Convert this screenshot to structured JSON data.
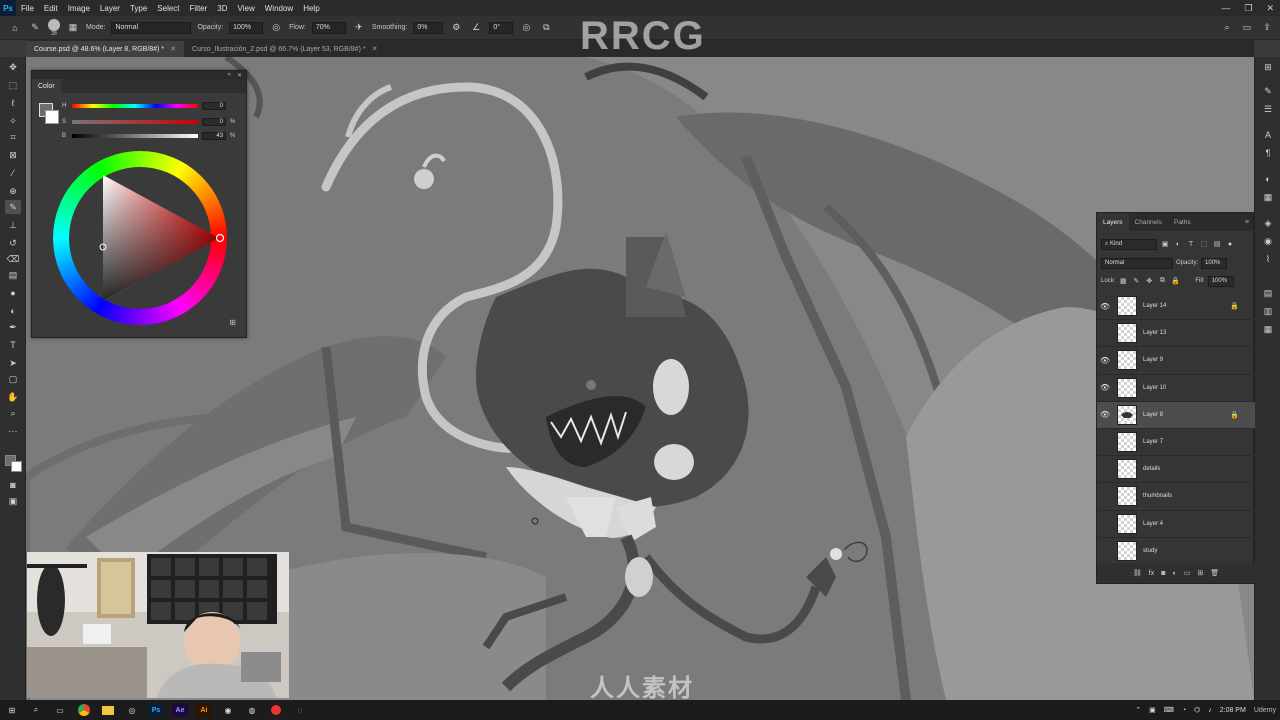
{
  "app": {
    "logo": "Ps"
  },
  "menu": [
    "File",
    "Edit",
    "Image",
    "Layer",
    "Type",
    "Select",
    "Filter",
    "3D",
    "View",
    "Window",
    "Help"
  ],
  "window_controls": [
    "—",
    "❐",
    "✕"
  ],
  "options": {
    "brush_size": "28",
    "mode_label": "Mode:",
    "mode_value": "Normal",
    "opacity_label": "Opacity:",
    "opacity_value": "100%",
    "flow_label": "Flow:",
    "flow_value": "70%",
    "smoothing_label": "Smoothing:",
    "smoothing_value": "0%",
    "angle_value": "0°"
  },
  "tabs": [
    {
      "label": "Course.psd @ 48.6% (Layer 8, RGB/8#) *",
      "active": true
    },
    {
      "label": "Curso_Ilustración_2.psd @ 66.7% (Layer 53, RGB/8#) *",
      "active": false
    }
  ],
  "color_panel": {
    "title": "Color",
    "sliders": [
      {
        "label": "H",
        "value": "0",
        "unit": ""
      },
      {
        "label": "S",
        "value": "0",
        "unit": "%"
      },
      {
        "label": "B",
        "value": "43",
        "unit": "%"
      }
    ]
  },
  "layers_panel": {
    "tabs": [
      "Layers",
      "Channels",
      "Paths"
    ],
    "filter_kind": "Kind",
    "blend_mode": "Normal",
    "opacity_label": "Opacity:",
    "opacity_value": "100%",
    "lock_label": "Lock:",
    "fill_label": "Fill:",
    "fill_value": "100%",
    "layers": [
      {
        "name": "Layer 14",
        "visible": true,
        "locked": true,
        "selected": false
      },
      {
        "name": "Layer 13",
        "visible": false,
        "locked": false,
        "selected": false
      },
      {
        "name": "Layer 9",
        "visible": true,
        "locked": false,
        "selected": false
      },
      {
        "name": "Layer 10",
        "visible": true,
        "locked": false,
        "selected": false
      },
      {
        "name": "Layer 8",
        "visible": true,
        "locked": true,
        "selected": true
      },
      {
        "name": "Layer 7",
        "visible": false,
        "locked": false,
        "selected": false
      },
      {
        "name": "details",
        "visible": false,
        "locked": false,
        "selected": false
      },
      {
        "name": "thumbnails",
        "visible": false,
        "locked": false,
        "selected": false
      },
      {
        "name": "Layer 4",
        "visible": false,
        "locked": false,
        "selected": false
      },
      {
        "name": "study",
        "visible": false,
        "locked": false,
        "selected": false
      }
    ]
  },
  "watermarks": {
    "top": "RRCG",
    "bottom": "人人素材"
  },
  "taskbar": {
    "clock": "2:08 PM",
    "brand": "Udemy"
  },
  "colors": {
    "accent": "#31a8ff",
    "canvas_bg": "#7c7c7c",
    "panel_bg": "#3a3a3a"
  }
}
